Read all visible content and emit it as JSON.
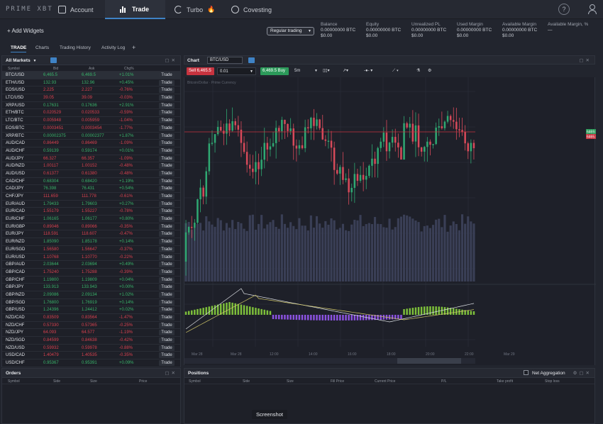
{
  "app": {
    "logo": "PRIME XBT",
    "nav": [
      {
        "label": "Account",
        "icon": "wallet-icon"
      },
      {
        "label": "Trade",
        "icon": "chart-icon"
      },
      {
        "label": "Turbo",
        "icon": "turbo-icon"
      },
      {
        "label": "Covesting",
        "icon": "covesting-icon"
      }
    ],
    "help_icon": "?"
  },
  "account_bar": {
    "add_widgets": "+ Add Widgets",
    "mode": "Regular trading",
    "stats": [
      {
        "label": "Balance",
        "btc": "0.00000000 BTC",
        "usd": "$0.00"
      },
      {
        "label": "Equity",
        "btc": "0.00000000 BTC",
        "usd": "$0.00"
      },
      {
        "label": "Unrealized PL",
        "btc": "0.00000000 BTC",
        "usd": "$0.00"
      },
      {
        "label": "Used Margin",
        "btc": "0.00000000 BTC",
        "usd": "$0.00"
      },
      {
        "label": "Available Margin",
        "btc": "0.00000000 BTC",
        "usd": "$0.00"
      },
      {
        "label": "Available Margin, %",
        "btc": "—",
        "usd": ""
      }
    ]
  },
  "tabs": [
    "TRADE",
    "Charts",
    "Trading History",
    "Activity Log",
    "+"
  ],
  "markets": {
    "title": "All Markets",
    "headers": {
      "symbol": "Symbol",
      "bid": "Bid",
      "ask": "Ask",
      "chg": "Chg%"
    },
    "trade_label": "Trade",
    "rows": [
      {
        "sym": "BTC/USD",
        "bid": "6,465.5",
        "ask": "6,469.5",
        "chg": "+1.01%",
        "dir": "up"
      },
      {
        "sym": "ETH/USD",
        "bid": "132.93",
        "ask": "132.96",
        "chg": "+0.45%",
        "dir": "up"
      },
      {
        "sym": "EOS/USD",
        "bid": "2.225",
        "ask": "2.227",
        "chg": "-0.76%",
        "dir": "dn"
      },
      {
        "sym": "LTC/USD",
        "bid": "39.05",
        "ask": "39.09",
        "chg": "-0.03%",
        "dir": "dn"
      },
      {
        "sym": "XRP/USD",
        "bid": "0.17631",
        "ask": "0.17636",
        "chg": "+2.91%",
        "dir": "up"
      },
      {
        "sym": "ETH/BTC",
        "bid": "0.020529",
        "ask": "0.020533",
        "chg": "-0.59%",
        "dir": "dn"
      },
      {
        "sym": "LTC/BTC",
        "bid": "0.005948",
        "ask": "0.005959",
        "chg": "-1.04%",
        "dir": "dn"
      },
      {
        "sym": "EOS/BTC",
        "bid": "0.0003451",
        "ask": "0.0003454",
        "chg": "-1.77%",
        "dir": "dn"
      },
      {
        "sym": "XRP/BTC",
        "bid": "0.00002375",
        "ask": "0.00002377",
        "chg": "+1.87%",
        "dir": "up"
      },
      {
        "sym": "AUD/CAD",
        "bid": "0.86449",
        "ask": "0.86469",
        "chg": "-1.09%",
        "dir": "dn"
      },
      {
        "sym": "AUD/CHF",
        "bid": "0.59139",
        "ask": "0.59174",
        "chg": "+0.01%",
        "dir": "up"
      },
      {
        "sym": "AUD/JPY",
        "bid": "66.327",
        "ask": "66.357",
        "chg": "-1.09%",
        "dir": "dn"
      },
      {
        "sym": "AUD/NZD",
        "bid": "1.00117",
        "ask": "1.00152",
        "chg": "-0.48%",
        "dir": "dn"
      },
      {
        "sym": "AUD/USD",
        "bid": "0.61377",
        "ask": "0.61380",
        "chg": "-0.48%",
        "dir": "dn"
      },
      {
        "sym": "CAD/CHF",
        "bid": "0.68304",
        "ask": "0.68420",
        "chg": "+1.19%",
        "dir": "up"
      },
      {
        "sym": "CAD/JPY",
        "bid": "76.398",
        "ask": "76.431",
        "chg": "+0.54%",
        "dir": "up"
      },
      {
        "sym": "CHF/JPY",
        "bid": "111.659",
        "ask": "111.778",
        "chg": "-0.61%",
        "dir": "dn"
      },
      {
        "sym": "EUR/AUD",
        "bid": "1.79433",
        "ask": "1.79603",
        "chg": "+0.27%",
        "dir": "up"
      },
      {
        "sym": "EUR/CAD",
        "bid": "1.55179",
        "ask": "1.55227",
        "chg": "-0.78%",
        "dir": "dn"
      },
      {
        "sym": "EUR/CHF",
        "bid": "1.06165",
        "ask": "1.06177",
        "chg": "+0.80%",
        "dir": "up"
      },
      {
        "sym": "EUR/GBP",
        "bid": "0.89046",
        "ask": "0.89066",
        "chg": "-0.35%",
        "dir": "dn"
      },
      {
        "sym": "EUR/JPY",
        "bid": "118.591",
        "ask": "118.607",
        "chg": "-0.47%",
        "dir": "dn"
      },
      {
        "sym": "EUR/NZD",
        "bid": "1.85090",
        "ask": "1.85178",
        "chg": "+0.14%",
        "dir": "up"
      },
      {
        "sym": "EUR/SGD",
        "bid": "1.56580",
        "ask": "1.56647",
        "chg": "-0.37%",
        "dir": "dn"
      },
      {
        "sym": "EUR/USD",
        "bid": "1.10768",
        "ask": "1.10770",
        "chg": "-0.22%",
        "dir": "dn"
      },
      {
        "sym": "GBP/AUD",
        "bid": "2.03644",
        "ask": "2.03694",
        "chg": "+0.49%",
        "dir": "up"
      },
      {
        "sym": "GBP/CAD",
        "bid": "1.75240",
        "ask": "1.75288",
        "chg": "-0.39%",
        "dir": "dn"
      },
      {
        "sym": "GBP/CHF",
        "bid": "1.19800",
        "ask": "1.19809",
        "chg": "+0.04%",
        "dir": "up"
      },
      {
        "sym": "GBP/JPY",
        "bid": "133.913",
        "ask": "133.943",
        "chg": "+0.00%",
        "dir": "up"
      },
      {
        "sym": "GBP/NZD",
        "bid": "2.09086",
        "ask": "2.09134",
        "chg": "+1.02%",
        "dir": "up"
      },
      {
        "sym": "GBP/SGD",
        "bid": "1.76800",
        "ask": "1.76919",
        "chg": "+0.14%",
        "dir": "up"
      },
      {
        "sym": "GBP/USD",
        "bid": "1.24396",
        "ask": "1.24412",
        "chg": "+0.02%",
        "dir": "up"
      },
      {
        "sym": "NZD/CAD",
        "bid": "0.83509",
        "ask": "0.83564",
        "chg": "-1.47%",
        "dir": "dn"
      },
      {
        "sym": "NZD/CHF",
        "bid": "0.57330",
        "ask": "0.57365",
        "chg": "-0.25%",
        "dir": "dn"
      },
      {
        "sym": "NZD/JPY",
        "bid": "64.093",
        "ask": "64.577",
        "chg": "-1.19%",
        "dir": "dn"
      },
      {
        "sym": "NZD/SGD",
        "bid": "0.84599",
        "ask": "0.84638",
        "chg": "-0.42%",
        "dir": "dn"
      },
      {
        "sym": "NZD/USD",
        "bid": "0.59932",
        "ask": "0.59978",
        "chg": "-0.88%",
        "dir": "dn"
      },
      {
        "sym": "USD/CAD",
        "bid": "1.40479",
        "ask": "1.40535",
        "chg": "-0.35%",
        "dir": "dn"
      },
      {
        "sym": "USD/CHF",
        "bid": "0.95367",
        "ask": "0.95391",
        "chg": "+0.09%",
        "dir": "up"
      }
    ]
  },
  "chart": {
    "title": "Chart",
    "symbol": "BTC/USD",
    "sell_label": "Sell 6,465.5",
    "amount": "0.01",
    "buy_label": "6,469.5 Buy",
    "interval": "5m",
    "price_tag_1": "6469.5",
    "price_tag_2": "6465.5",
    "legend": "Bitcoin/Dollar · Prime Currency",
    "time_labels": [
      "Mar 28",
      "Mar 28",
      "12:00",
      "14:00",
      "16:00",
      "18:00",
      "20:00",
      "22:00",
      "Mar 29"
    ]
  },
  "orders": {
    "title": "Orders",
    "headers": [
      "Symbol",
      "Side",
      "Size",
      "Price"
    ]
  },
  "positions": {
    "title": "Positions",
    "net_aggregation": "Net Aggregation",
    "headers": [
      "Symbol",
      "Side",
      "Size",
      "Fill Price",
      "Current Price",
      "P/L",
      "Take profit",
      "Stop loss"
    ]
  },
  "toast": "Screenshot",
  "colors": {
    "up": "#39b36a",
    "down": "#d9414f",
    "accent": "#3f83c6"
  }
}
